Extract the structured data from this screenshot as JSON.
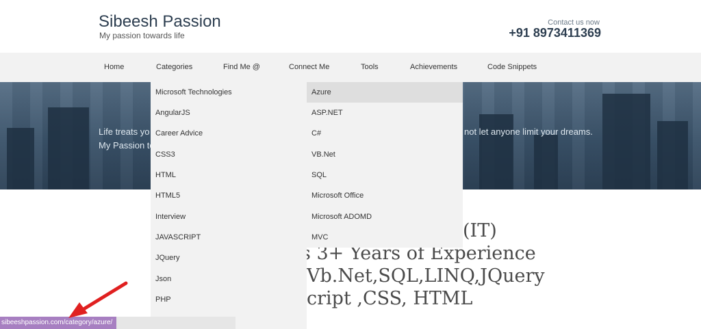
{
  "header": {
    "title": "Sibeesh Passion",
    "tagline": "My passion towards life",
    "contact_label": "Contact us now",
    "contact_phone": "+91 8973411369"
  },
  "nav": {
    "items": [
      "Home",
      "Categories",
      "Find Me @",
      "Connect Me",
      "Tools",
      "Achievements",
      "Code Snippets"
    ]
  },
  "hero": {
    "line1": "Life treats yo",
    "line1_right": "not let anyone limit your dreams.",
    "line2": "My Passion to"
  },
  "main": {
    "lines": [
      "(IT)",
      "s 3+ Years of Experience",
      "Vb.Net,SQL,LINQ,JQuery",
      "cript ,CSS, HTML"
    ]
  },
  "dropdown_categories": {
    "items": [
      "Microsoft Technologies",
      "AngularJS",
      "Career Advice",
      "CSS3",
      "HTML",
      "HTML5",
      "Interview",
      "JAVASCRIPT",
      "JQuery",
      "Json",
      "PHP"
    ]
  },
  "dropdown_microsoft": {
    "items": [
      "Azure",
      "ASP.NET",
      "C#",
      "VB.Net",
      "SQL",
      "Microsoft Office",
      "Microsoft ADOMD",
      "MVC"
    ],
    "active_index": 0
  },
  "status_bar": {
    "url": "sibeeshpassion.com/category/azure/"
  },
  "colors": {
    "accent": "#2d3e50",
    "nav_bg": "#f2f2f2",
    "status_bg": "#a77fc1",
    "arrow": "#e02020"
  }
}
